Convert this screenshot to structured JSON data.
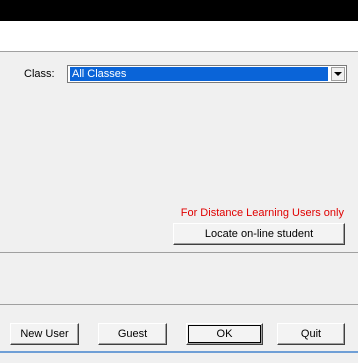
{
  "class_field": {
    "label": "Class:",
    "selected": "All Classes"
  },
  "distance_learning_note": "For Distance Learning Users only",
  "buttons": {
    "locate": "Locate on-line student",
    "new_user": "New User",
    "guest": "Guest",
    "ok": "OK",
    "quit": "Quit"
  },
  "colors": {
    "selection": "#0a64d8",
    "note_text": "#e00000"
  }
}
